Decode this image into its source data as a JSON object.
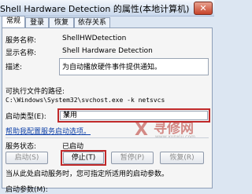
{
  "window": {
    "title": "Shell Hardware Detection 的属性(本地计算机)",
    "close_label": "✕"
  },
  "tabs": [
    "常规",
    "登录",
    "恢复",
    "依存关系"
  ],
  "general": {
    "service_name_label": "服务名称:",
    "service_name": "ShellHWDetection",
    "display_name_label": "显示名称:",
    "display_name": "Shell Hardware Detection",
    "description_label": "描述:",
    "description": "为自动播放硬件事件提供通知。",
    "exe_path_label": "可执行文件的路径:",
    "exe_path": "C:\\Windows\\System32\\svchost.exe -k netsvcs",
    "startup_type_label": "启动类型(E):",
    "startup_type_value": "禁用",
    "help_link": "帮助我配置服务启动选项。",
    "status_label": "服务状态:",
    "status_value": "已启动",
    "buttons": {
      "start": "启动(S)",
      "stop": "停止(T)",
      "pause": "暂停(P)",
      "resume": "恢复(R)"
    },
    "hint": "当从此处启动服务时，您可指定所适用的启动参数。",
    "params_label": "启动参数(M):"
  },
  "watermark": {
    "mark": "X",
    "text": "寻修网",
    "url": "www.xunxiu.com"
  }
}
